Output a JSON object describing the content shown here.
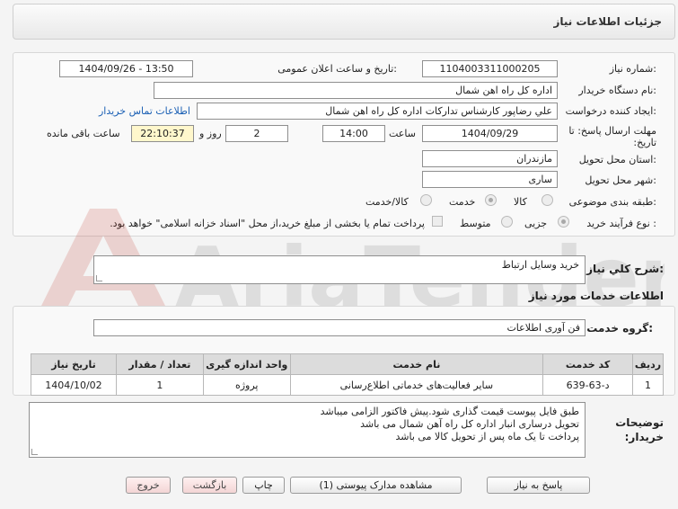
{
  "header": {
    "title": "جزئیات اطلاعات نیاز"
  },
  "watermark": {
    "text": "AriaTender.net"
  },
  "form": {
    "need_number": {
      "label": "شماره نیاز:",
      "value": "1104003311000205"
    },
    "announce_datetime": {
      "label": "تاریخ و ساعت اعلان عمومی:",
      "value": "1404/09/26 - 13:50"
    },
    "buyer_org": {
      "label": "نام دستگاه خریدار:",
      "value": "اداره کل راه اهن شمال"
    },
    "requester": {
      "label": "ایجاد کننده درخواست:",
      "value": "علي رضاپور کارشناس تدارکات اداره کل راه اهن شمال"
    },
    "buyer_contact_link": "اطلاعات تماس خریدار",
    "deadline": {
      "label": "مهلت ارسال پاسخ: تا تاریخ:",
      "date": "1404/09/29",
      "time_label": "ساعت",
      "time": "14:00",
      "days": "2",
      "days_label": "روز و",
      "remaining": "22:10:37",
      "remaining_label": "ساعت باقی مانده"
    },
    "province": {
      "label": "استان محل تحویل:",
      "value": "مازندران"
    },
    "city": {
      "label": "شهر محل تحویل:",
      "value": "ساری"
    },
    "category": {
      "label": "طبقه بندی موضوعی:",
      "options": [
        "کالا",
        "خدمت",
        "کالا/خدمت"
      ],
      "selected": "خدمت"
    },
    "purchase_type": {
      "label": "نوع فرآیند خرید :",
      "options": [
        "جزیی",
        "متوسط"
      ],
      "selected": "جزیی",
      "note": "پرداخت تمام یا بخشی از مبلغ خرید،از محل \"اسناد خزانه اسلامی\" خواهد بود."
    }
  },
  "summary": {
    "label": "شرح كلي نياز:",
    "value": "خرید وسایل ارتباط"
  },
  "services": {
    "title": "اطلاعات خدمات مورد نیاز",
    "group_label": "گروه خدمت:",
    "group_value": "فن آوری اطلاعات",
    "columns": [
      "ردیف",
      "کد خدمت",
      "نام خدمت",
      "واحد اندازه گیری",
      "تعداد / مقدار",
      "تاریخ نیاز"
    ],
    "rows": [
      [
        "1",
        "د-63-639",
        "سایر فعالیت‌های خدماتی اطلاع‌رسانی",
        "پروژه",
        "1",
        "1404/10/02"
      ]
    ]
  },
  "buyer_notes": {
    "label": "توضیحات خریدار:",
    "lines": [
      "طبق فایل پیوست قیمت گذاری شود.پیش فاکتور الزامی میباشد",
      "تحویل درساری انبار اداره کل راه آهن شمال  می باشد",
      "پرداخت تا یک ماه پس از تحویل کالا می باشد"
    ]
  },
  "buttons": {
    "reply": "پاسخ به نیاز",
    "attachments": "مشاهده مدارک پیوستی (1)",
    "print": "چاپ",
    "back": "بازگشت",
    "exit": "خروج"
  }
}
